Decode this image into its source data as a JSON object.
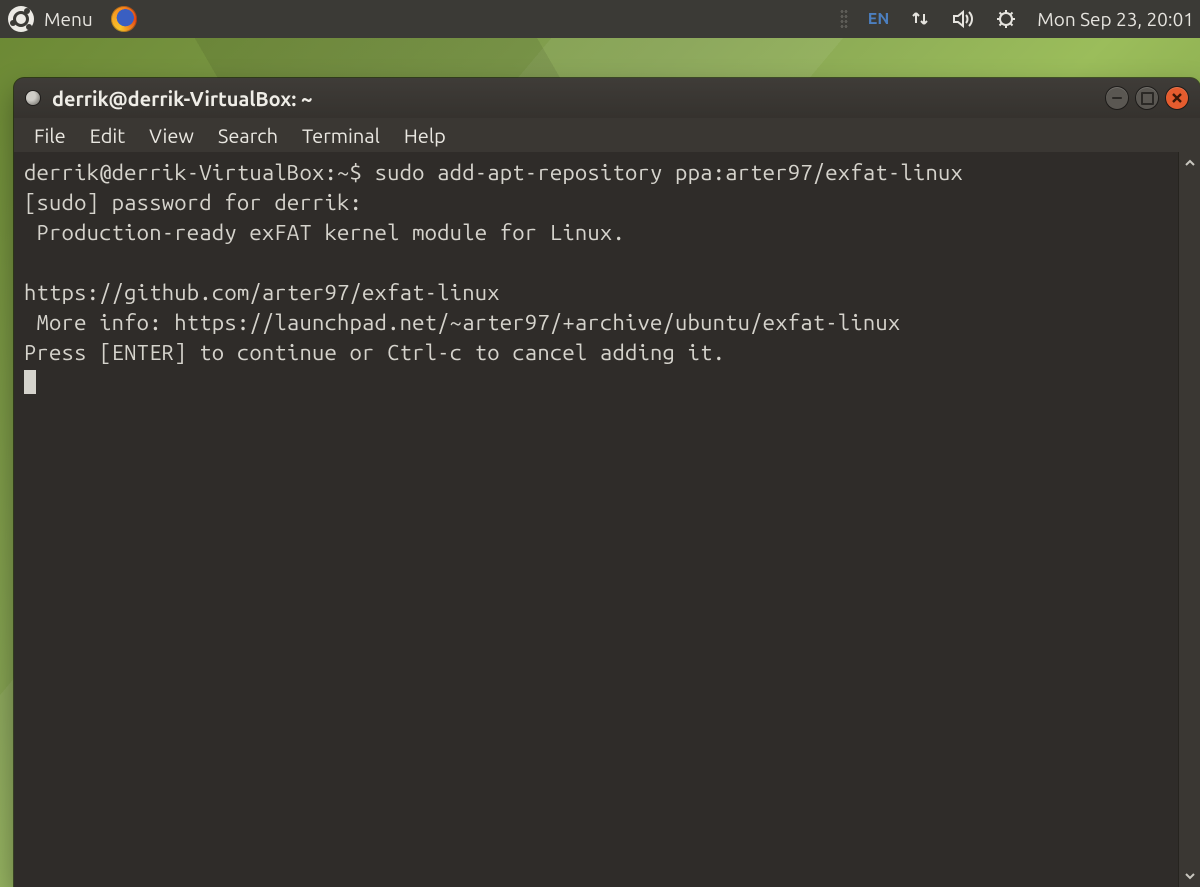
{
  "panel": {
    "menu_label": "Menu",
    "lang": "EN",
    "clock": "Mon Sep 23, 20:01"
  },
  "window": {
    "title": "derrik@derrik-VirtualBox: ~",
    "menubar": [
      "File",
      "Edit",
      "View",
      "Search",
      "Terminal",
      "Help"
    ]
  },
  "terminal": {
    "prompt": "derrik@derrik-VirtualBox:~$ ",
    "command": "sudo add-apt-repository ppa:arter97/exfat-linux",
    "lines": [
      "[sudo] password for derrik: ",
      " Production-ready exFAT kernel module for Linux.",
      "",
      "https://github.com/arter97/exfat-linux",
      " More info: https://launchpad.net/~arter97/+archive/ubuntu/exfat-linux",
      "Press [ENTER] to continue or Ctrl-c to cancel adding it."
    ]
  }
}
